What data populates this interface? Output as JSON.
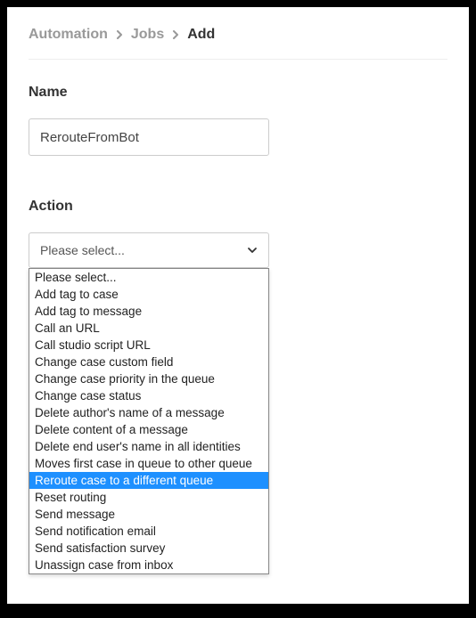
{
  "breadcrumb": {
    "item1": "Automation",
    "item2": "Jobs",
    "current": "Add"
  },
  "name_section": {
    "label": "Name",
    "value": "RerouteFromBot"
  },
  "action_section": {
    "label": "Action",
    "placeholder": "Please select...",
    "selected_index": 12,
    "options": [
      "Please select...",
      "Add tag to case",
      "Add tag to message",
      "Call an URL",
      "Call studio script URL",
      "Change case custom field",
      "Change case priority in the queue",
      "Change case status",
      "Delete author's name of a message",
      "Delete content of a message",
      "Delete end user's name in all identities",
      "Moves first case in queue to other queue",
      "Reroute case to a different queue",
      "Reset routing",
      "Send message",
      "Send notification email",
      "Send satisfaction survey",
      "Unassign case from inbox"
    ]
  }
}
